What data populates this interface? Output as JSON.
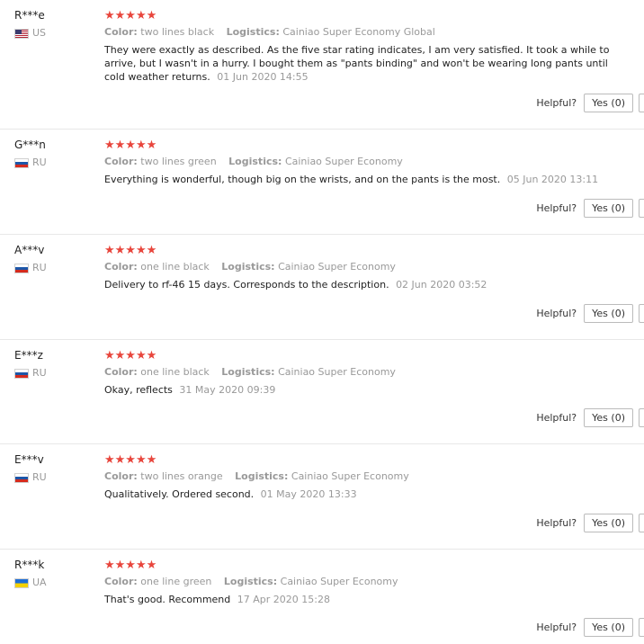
{
  "labels": {
    "color_key": "Color:",
    "logistics_key": "Logistics:",
    "helpful": "Helpful?",
    "yes": "Yes (0)"
  },
  "colors": {
    "star": "#e8453c",
    "muted": "#999999",
    "text": "#222222",
    "divider": "#e8e8e8"
  },
  "reviews": [
    {
      "user": "R***e",
      "flag_icon": "us-flag-icon",
      "country": "US",
      "stars": 5,
      "color": "two lines black",
      "logistics": "Cainiao Super Economy Global",
      "text": "They were exactly as described. As the five star rating indicates, I am very satisfied. It took a while to arrive, but I wasn't in a hurry. I bought them as \"pants binding\" and won't be wearing long pants until cold weather returns.",
      "date": "01 Jun 2020 14:55"
    },
    {
      "user": "G***n",
      "flag_icon": "ru-flag-icon",
      "country": "RU",
      "stars": 5,
      "color": "two lines green",
      "logistics": "Cainiao Super Economy",
      "text": "Everything is wonderful, though big on the wrists, and on the pants is the most.",
      "date": "05 Jun 2020 13:11"
    },
    {
      "user": "A***v",
      "flag_icon": "ru-flag-icon",
      "country": "RU",
      "stars": 5,
      "color": "one line black",
      "logistics": "Cainiao Super Economy",
      "text": "Delivery to rf-46 15 days. Corresponds to the description.",
      "date": "02 Jun 2020 03:52"
    },
    {
      "user": "E***z",
      "flag_icon": "ru-flag-icon",
      "country": "RU",
      "stars": 5,
      "color": "one line black",
      "logistics": "Cainiao Super Economy",
      "text": "Okay, reflects",
      "date": "31 May 2020 09:39"
    },
    {
      "user": "E***v",
      "flag_icon": "ru-flag-icon",
      "country": "RU",
      "stars": 5,
      "color": "two lines orange",
      "logistics": "Cainiao Super Economy",
      "text": "Qualitatively. Ordered second.",
      "date": "01 May 2020 13:33"
    },
    {
      "user": "R***k",
      "flag_icon": "ua-flag-icon",
      "country": "UA",
      "stars": 5,
      "color": "one line green",
      "logistics": "Cainiao Super Economy",
      "text": "That's good. Recommend",
      "date": "17 Apr 2020 15:28"
    }
  ]
}
